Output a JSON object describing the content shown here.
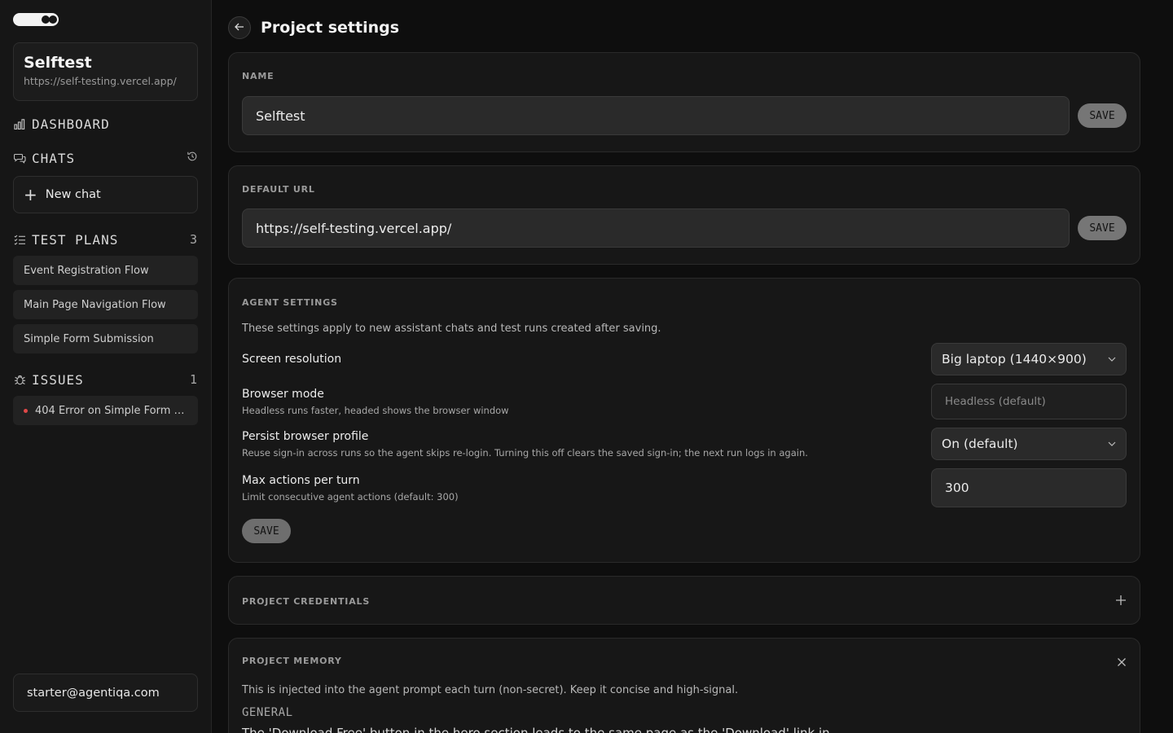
{
  "sidebar": {
    "project": {
      "name": "Selftest",
      "url": "https://self-testing.vercel.app/"
    },
    "dashboard_label": "DASHBOARD",
    "chats_label": "CHATS",
    "new_chat_label": "New chat",
    "test_plans": {
      "label": "TEST PLANS",
      "count": "3",
      "items": [
        "Event Registration Flow",
        "Main Page Navigation Flow",
        "Simple Form Submission"
      ]
    },
    "issues": {
      "label": "ISSUES",
      "count": "1",
      "items": [
        "404 Error on Simple Form p..."
      ]
    },
    "user_email": "starter@agentiqa.com"
  },
  "main": {
    "title": "Project settings",
    "name_card": {
      "label": "NAME",
      "value": "Selftest",
      "save": "SAVE"
    },
    "url_card": {
      "label": "DEFAULT URL",
      "value": "https://self-testing.vercel.app/",
      "save": "SAVE"
    },
    "agent": {
      "label": "AGENT SETTINGS",
      "description": "These settings apply to new assistant chats and test runs created after saving.",
      "screen_resolution": {
        "title": "Screen resolution",
        "value": "Big laptop (1440×900)"
      },
      "browser_mode": {
        "title": "Browser mode",
        "sub": "Headless runs faster, headed shows the browser window",
        "value": "Headless (default)"
      },
      "persist_profile": {
        "title": "Persist browser profile",
        "sub": "Reuse sign-in across runs so the agent skips re-login. Turning this off clears the saved sign-in; the next run logs in again.",
        "value": "On (default)"
      },
      "max_actions": {
        "title": "Max actions per turn",
        "sub": "Limit consecutive agent actions (default: 300)",
        "value": "300"
      },
      "save": "SAVE"
    },
    "credentials": {
      "label": "PROJECT CREDENTIALS"
    },
    "memory": {
      "label": "PROJECT MEMORY",
      "description": "This is injected into the agent prompt each turn (non-secret). Keep it concise and high-signal.",
      "section": "GENERAL",
      "text": "The 'Download Free' button in the hero section leads to the same page as the 'Download' link in"
    }
  }
}
